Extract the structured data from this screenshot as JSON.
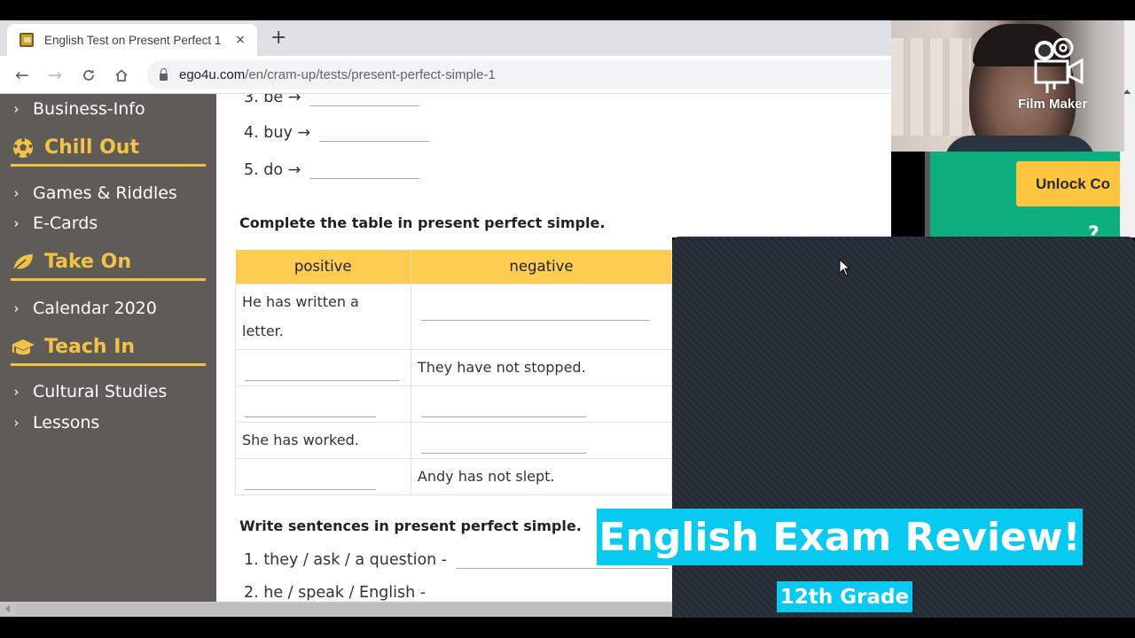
{
  "browser": {
    "tab_title": "English Test on Present Perfect 1",
    "tab_close": "×",
    "new_tab": "+",
    "url_host": "ego4u.com",
    "url_path": "/en/cram-up/tests/present-perfect-simple-1",
    "nav": {
      "back": "←",
      "forward": "→",
      "reload": "C",
      "home": "⌂"
    }
  },
  "sidebar": {
    "chevron": "›",
    "items": [
      {
        "type": "item",
        "label": "Business-Info"
      },
      {
        "type": "heading",
        "label": "Chill Out",
        "icon": "soccer-ball-icon"
      },
      {
        "type": "item",
        "label": "Games & Riddles"
      },
      {
        "type": "item",
        "label": "E-Cards"
      },
      {
        "type": "heading",
        "label": "Take On",
        "icon": "leaf-icon"
      },
      {
        "type": "item",
        "label": "Calendar 2020"
      },
      {
        "type": "heading",
        "label": "Teach In",
        "icon": "graduation-cap-icon"
      },
      {
        "type": "item",
        "label": "Cultural Studies"
      },
      {
        "type": "item",
        "label": "Lessons"
      }
    ]
  },
  "exercise1": {
    "items": [
      {
        "label": "3. be →"
      },
      {
        "label": "4. buy →"
      },
      {
        "label": "5. do →"
      }
    ]
  },
  "exercise2": {
    "title": "Complete the table in present perfect simple.",
    "headers": [
      "positive",
      "negative"
    ],
    "rows": [
      {
        "positive": "He has written a letter.",
        "negative": ""
      },
      {
        "positive": "",
        "negative": "They have not stopped."
      },
      {
        "positive": "",
        "negative": ""
      },
      {
        "positive": "She has worked.",
        "negative": ""
      },
      {
        "positive": "",
        "negative": "Andy has not slept."
      }
    ]
  },
  "exercise3": {
    "title": "Write sentences in present perfect simple.",
    "items": [
      {
        "label": "1. they / ask / a question -"
      },
      {
        "label": "2. he / speak / English -"
      }
    ]
  },
  "ad": {
    "button_label": "Unlock Co",
    "glyph": "?"
  },
  "webcam": {
    "overlay_label": "Film Maker"
  },
  "video_overlay": {
    "title": "English Exam Review!",
    "subtitle": "12th Grade",
    "banner_color": "#08c9f0"
  },
  "colors": {
    "accent": "#f4c246",
    "table_header": "#fdcd52",
    "sidebar_bg": "#5f5c58",
    "ad_green": "#0daf7e"
  }
}
